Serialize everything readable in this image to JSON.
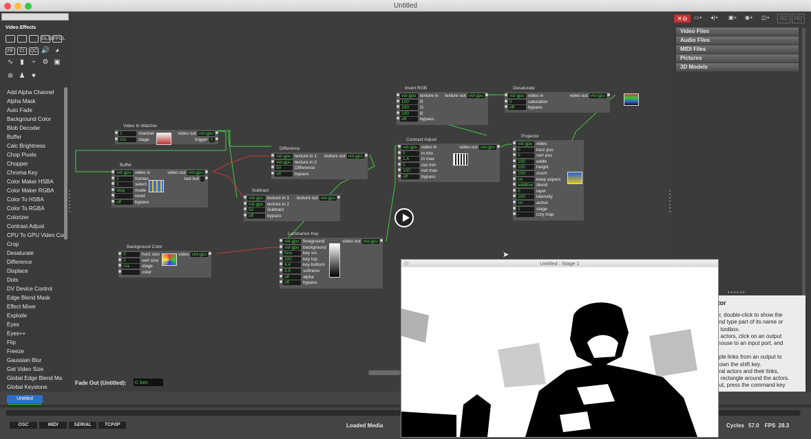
{
  "window": {
    "title": "Untitled"
  },
  "left_panel": {
    "title": "Video Effects",
    "icons_row1": [
      "frame-icon",
      "frame-in-icon",
      "frame-out-icon",
      "glsl-icon",
      "fxgl-icon"
    ],
    "icons_row1_labels": [
      "",
      "",
      "",
      "GLSL",
      "FFGL"
    ],
    "icons_row2_labels": [
      "FF",
      "CI",
      "QC",
      "",
      ""
    ],
    "effects": [
      "Add Alpha Channel",
      "Alpha Mask",
      "Auto Fade",
      "Background Color",
      "Blob Decoder",
      "Buffer",
      "Calc Brightness",
      "Chop Pixels",
      "Chopper",
      "Chroma Key",
      "Color Maker HSBA",
      "Color Maker RGBA",
      "Color To HSBA",
      "Color To RGBA",
      "Colorizer",
      "Contrast Adjust",
      "CPU To GPU Video Con",
      "Crop",
      "Desaturate",
      "Difference",
      "Displace",
      "Dots",
      "DV Device Control",
      "Edge Blend Mask",
      "Effect Mixer",
      "Explode",
      "Eyes",
      "Eyes++",
      "Flip",
      "Freeze",
      "Gaussian Blur",
      "Get Video Size",
      "Global Edge Blend Ma",
      "Global Keystone"
    ]
  },
  "actors": {
    "video_in_watcher": {
      "title": "Video In Watcher",
      "inputs": [
        [
          "1",
          "channel"
        ],
        [
          "n/a",
          "stage"
        ]
      ],
      "outputs": [
        [
          "video out",
          "vid-gpu"
        ],
        [
          "trigger",
          "X"
        ]
      ]
    },
    "buffer": {
      "title": "Buffer",
      "inputs": [
        [
          "vid-gpu",
          "video in"
        ],
        [
          "2",
          "frames"
        ],
        [
          "1",
          "select"
        ],
        [
          "stop",
          "mode"
        ],
        [
          "-",
          "reset"
        ],
        [
          "off",
          "bypass"
        ]
      ],
      "outputs": [
        [
          "video out",
          "vid-gpu"
        ],
        [
          "last buf",
          "-"
        ]
      ]
    },
    "difference": {
      "title": "Difference",
      "inputs": [
        [
          "vid-gpu",
          "texture in 1"
        ],
        [
          "vid-gpu",
          "texture in 2"
        ],
        [
          "50",
          "Difference"
        ],
        [
          "off",
          "bypass"
        ]
      ],
      "outputs": [
        [
          "texture out",
          "vid-gpu"
        ]
      ]
    },
    "subtract": {
      "title": "Subtract",
      "inputs": [
        [
          "vid-gpu",
          "texture in 1"
        ],
        [
          "vid-gpu",
          "texture in 2"
        ],
        [
          "50",
          "Subtract"
        ],
        [
          "off",
          "bypass"
        ]
      ],
      "outputs": [
        [
          "texture out",
          "vid-gpu"
        ]
      ]
    },
    "background_color": {
      "title": "Background Color",
      "inputs": [
        [
          "0",
          "horz size"
        ],
        [
          "0",
          "vert size"
        ],
        [
          "n/a",
          "stage"
        ],
        [
          "",
          "color"
        ]
      ],
      "outputs": [
        [
          "video",
          "vid-gpu"
        ]
      ]
    },
    "luminance_key": {
      "title": "Luminance Key",
      "inputs": [
        [
          "vid-gpu",
          "foreground"
        ],
        [
          "vid-gpu",
          "background"
        ],
        [
          "fore",
          "key src"
        ],
        [
          "100",
          "key top"
        ],
        [
          "4.4",
          "key bottom"
        ],
        [
          "3.9",
          "softness"
        ],
        [
          "off",
          "alpha"
        ],
        [
          "off",
          "bypass"
        ]
      ],
      "outputs": [
        [
          "video out",
          "vid-gpu"
        ]
      ]
    },
    "invert_rgb": {
      "title": "Invert RGB",
      "inputs": [
        [
          "vid-gpu",
          "texture in"
        ],
        [
          "100",
          "R"
        ],
        [
          "100",
          "G"
        ],
        [
          "100",
          "B"
        ],
        [
          "off",
          "bypass"
        ]
      ],
      "outputs": [
        [
          "texture out",
          "vid-gpu"
        ]
      ]
    },
    "desaturate": {
      "title": "Desaturate",
      "inputs": [
        [
          "vid-gpu",
          "video in"
        ],
        [
          "0",
          "saturation"
        ],
        [
          "off",
          "bypass"
        ]
      ],
      "outputs": [
        [
          "video out",
          "vid-gpu"
        ]
      ]
    },
    "contrast_adjust": {
      "title": "Contrast Adjust",
      "inputs": [
        [
          "vid-gpu",
          "video in"
        ],
        [
          "0",
          "in min"
        ],
        [
          "1.4",
          "in max"
        ],
        [
          "0",
          "out min"
        ],
        [
          "100",
          "out max"
        ],
        [
          "off",
          "bypass"
        ]
      ],
      "outputs": [
        [
          "video out",
          "vid-gpu"
        ]
      ]
    },
    "projector": {
      "title": "Projector",
      "inputs": [
        [
          "vid-gpu",
          "video"
        ],
        [
          "0",
          "horz pos"
        ],
        [
          "0",
          "vert pos"
        ],
        [
          "100",
          "width"
        ],
        [
          "100",
          "height"
        ],
        [
          "100",
          "zoom"
        ],
        [
          "on",
          "keep aspect"
        ],
        [
          "additive",
          "blend"
        ],
        [
          "0",
          "layer"
        ],
        [
          "100",
          "intensity"
        ],
        [
          "on",
          "active"
        ],
        [
          "1",
          "stage"
        ],
        [
          "-",
          "izzy map"
        ]
      ],
      "outputs": []
    }
  },
  "canvas": {
    "fade_label": "Fade Out (Untitled):",
    "fade_value": "0 Sec"
  },
  "right_panel": {
    "tool_labels": [
      "SQ",
      "HQ"
    ],
    "folders": [
      "Video Files",
      "Audio Files",
      "MIDI Files",
      "Pictures",
      "3D Models"
    ]
  },
  "help": {
    "title": "itor",
    "lines": [
      "or, double-click to show the",
      "and type part of its name or",
      "e toolbox.",
      "o actors, click on an output",
      "mouse to an input port, and",
      "",
      "tiple links from an output to",
      "down the shift key.",
      "eral actors and their links,",
      "n rectangle around the actors.",
      "out, press the command key"
    ]
  },
  "stage": {
    "title": "Untitled : Stage 1"
  },
  "bottom": {
    "scene_tab": "Untitled",
    "tabs": [
      "OSC",
      "MIDI",
      "SERIAL",
      "TCP/IP"
    ],
    "loaded_media": "Loaded Media",
    "cycles_label": "Cycles",
    "cycles": "57.0",
    "fps_label": "FPS",
    "fps": "28.3"
  },
  "colors": {
    "link_green": "#3ecf3e",
    "link_red": "#c43a3a",
    "value_green": "#4fd24f",
    "scene_tab": "#2e6fc7"
  }
}
